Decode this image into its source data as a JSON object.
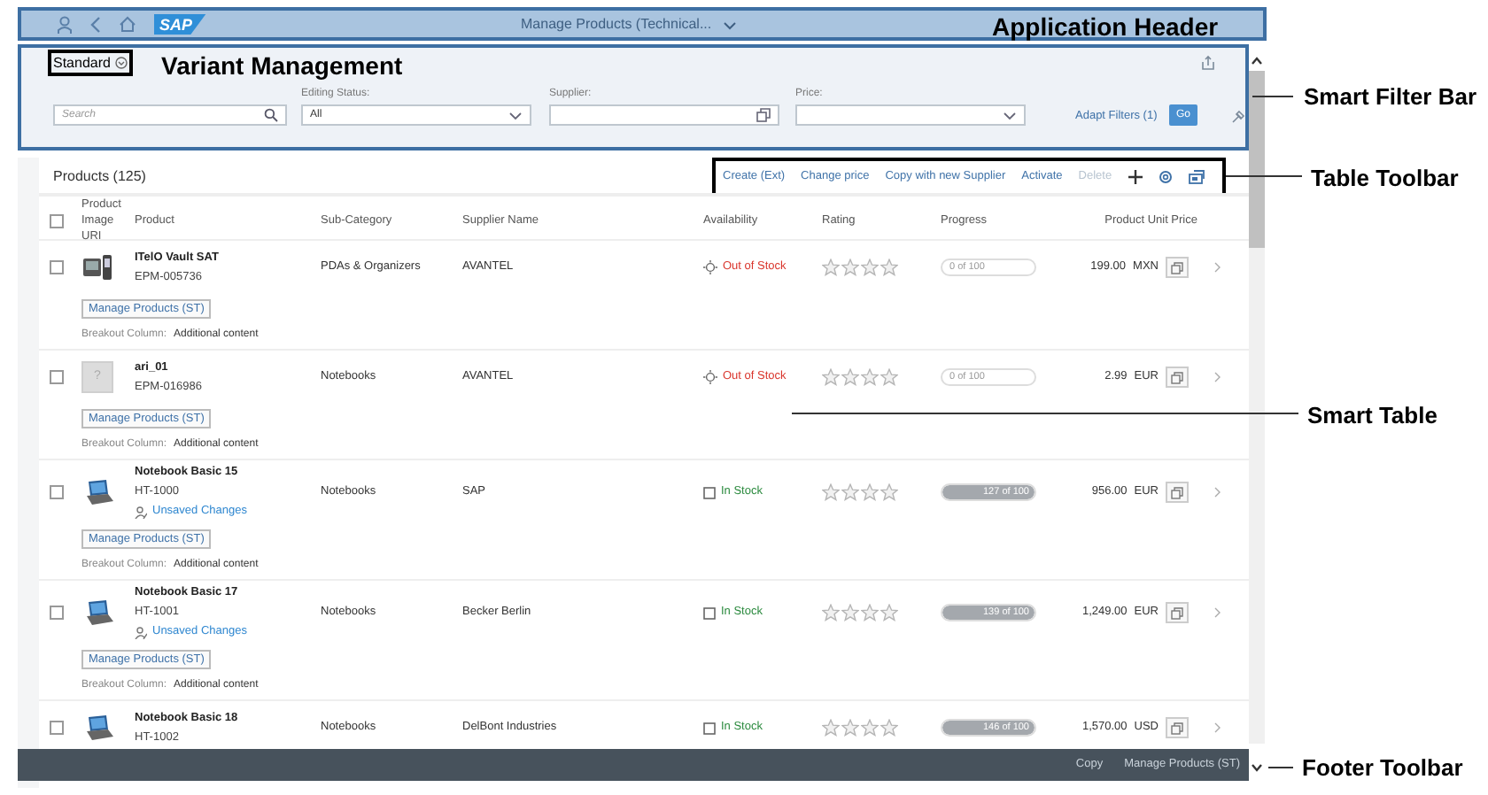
{
  "header": {
    "logo_text": "SAP",
    "title": "Manage Products (Technical...",
    "annotation": "Application Header"
  },
  "filter_bar": {
    "variant": "Standard",
    "variant_annotation": "Variant Management",
    "fields": [
      {
        "kind": "search",
        "placeholder": "Search"
      },
      {
        "kind": "select",
        "label": "Editing Status:",
        "value": "All"
      },
      {
        "kind": "valuehelp",
        "label": "Supplier:"
      },
      {
        "kind": "select",
        "label": "Price:"
      }
    ],
    "adapt_filters": "Adapt Filters (1)",
    "go": "Go",
    "annotation": "Smart Filter Bar"
  },
  "table": {
    "title": "Products (125)",
    "toolbar_annotation": "Table Toolbar",
    "annotation": "Smart Table",
    "actions": [
      {
        "label": "Create (Ext)",
        "disabled": false
      },
      {
        "label": "Change price",
        "disabled": false
      },
      {
        "label": "Copy with new Supplier",
        "disabled": false
      },
      {
        "label": "Activate",
        "disabled": false
      },
      {
        "label": "Delete",
        "disabled": true
      }
    ],
    "select_all": false,
    "columns": [
      "Product Image URI",
      "Product",
      "Sub-Category",
      "Supplier Name",
      "Availability",
      "Rating",
      "Progress",
      "Product Unit Price"
    ],
    "rows": [
      {
        "image": {
          "kind": "handheld"
        },
        "name": "ITelO Vault SAT",
        "id": "EPM-005736",
        "unsaved": false,
        "sub_category": "PDAs & Organizers",
        "supplier": "AVANTEL",
        "availability": {
          "kind": "out",
          "text": "Out of Stock"
        },
        "stars": 0,
        "progress": {
          "text": "0 of 100",
          "level": 0
        },
        "price": "199.00",
        "currency": "MXN",
        "selected": false,
        "button": "Manage Products (ST)",
        "breakout_label": "Breakout Column:",
        "breakout_value": "Additional content"
      },
      {
        "image": {
          "kind": "placeholder",
          "text": "?"
        },
        "name": "ari_01",
        "id": "EPM-016986",
        "unsaved": false,
        "sub_category": "Notebooks",
        "supplier": "AVANTEL",
        "availability": {
          "kind": "out",
          "text": "Out of Stock"
        },
        "stars": 0,
        "progress": {
          "text": "0 of 100",
          "level": 0
        },
        "price": "2.99",
        "currency": "EUR",
        "selected": false,
        "button": "Manage Products (ST)",
        "breakout_label": "Breakout Column:",
        "breakout_value": "Additional content"
      },
      {
        "image": {
          "kind": "laptop"
        },
        "name": "Notebook Basic 15",
        "id": "HT-1000",
        "unsaved": true,
        "unsaved_text": "Unsaved Changes",
        "sub_category": "Notebooks",
        "supplier": "SAP",
        "availability": {
          "kind": "in",
          "text": "In Stock"
        },
        "stars": 0,
        "progress": {
          "text": "127 of 100",
          "level": 1
        },
        "price": "956.00",
        "currency": "EUR",
        "selected": false,
        "button": "Manage Products (ST)",
        "breakout_label": "Breakout Column:",
        "breakout_value": "Additional content"
      },
      {
        "image": {
          "kind": "laptop"
        },
        "name": "Notebook Basic 17",
        "id": "HT-1001",
        "unsaved": true,
        "unsaved_text": "Unsaved Changes",
        "sub_category": "Notebooks",
        "supplier": "Becker Berlin",
        "availability": {
          "kind": "in",
          "text": "In Stock"
        },
        "stars": 0,
        "progress": {
          "text": "139 of 100",
          "level": 1
        },
        "price": "1,249.00",
        "currency": "EUR",
        "selected": false,
        "button": "Manage Products (ST)",
        "breakout_label": "Breakout Column:",
        "breakout_value": "Additional content"
      },
      {
        "image": {
          "kind": "laptop"
        },
        "name": "Notebook Basic 18",
        "id": "HT-1002",
        "unsaved": false,
        "sub_category": "Notebooks",
        "supplier": "DelBont Industries",
        "availability": {
          "kind": "in",
          "text": "In Stock"
        },
        "stars": 0,
        "progress": {
          "text": "146 of 100",
          "level": 1
        },
        "price": "1,570.00",
        "currency": "USD",
        "selected": false
      }
    ]
  },
  "footer": {
    "actions": [
      "Copy",
      "Manage Products (ST)"
    ],
    "annotation": "Footer Toolbar"
  }
}
